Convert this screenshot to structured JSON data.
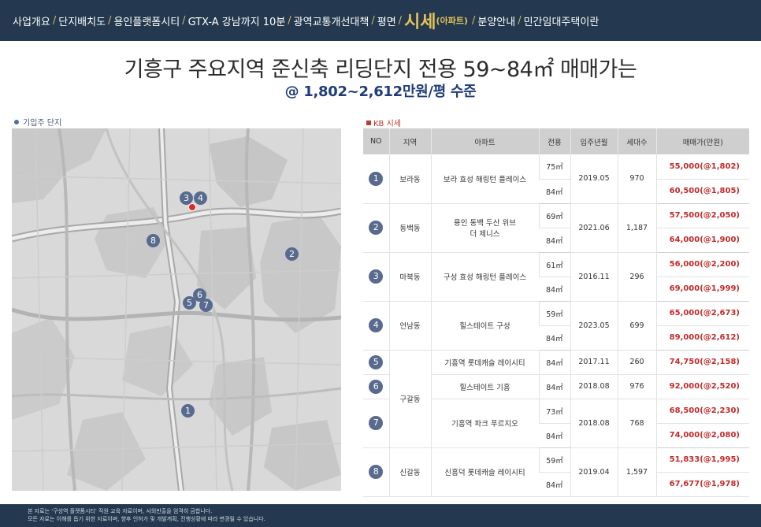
{
  "nav": {
    "items": [
      "사업개요",
      "단지배치도",
      "용인플랫폼시티",
      "GTX-A 강남까지 10분",
      "광역교통개선대책",
      "평면"
    ],
    "active": "시세",
    "active_sub": "(아파트)",
    "items_after": [
      "분양안내",
      "민간임대주택이란"
    ],
    "separator": "/"
  },
  "headline": {
    "main": "기흥구 주요지역 준신축 리딩단지 전용 59~84㎡ 매매가는",
    "sub": "@ 1,802~2,612만원/평 수준"
  },
  "map": {
    "legend": "기입주 단지"
  },
  "table": {
    "title": "KB 시세",
    "headers": [
      "NO",
      "지역",
      "아파트",
      "전용",
      "입주년월",
      "세대수",
      "매매가(만원)"
    ],
    "groups": [
      {
        "region": "보라동",
        "entries": [
          {
            "no": "1",
            "apt": "보라 효성 해링턴 플레이스",
            "move_in": "2019.05",
            "households": "970",
            "rows": [
              {
                "area": "75㎡",
                "price": "55,000(@1,802)"
              },
              {
                "area": "84㎡",
                "price": "60,500(@1,805)"
              }
            ]
          }
        ]
      },
      {
        "region": "동백동",
        "entries": [
          {
            "no": "2",
            "apt": "용인 동백 두산 위브 더 제니스",
            "move_in": "2021.06",
            "households": "1,187",
            "rows": [
              {
                "area": "69㎡",
                "price": "57,500(@2,050)"
              },
              {
                "area": "84㎡",
                "price": "64,000(@1,900)"
              }
            ]
          }
        ]
      },
      {
        "region": "마북동",
        "entries": [
          {
            "no": "3",
            "apt": "구성 효성 해링턴 플레이스",
            "move_in": "2016.11",
            "households": "296",
            "rows": [
              {
                "area": "61㎡",
                "price": "56,000(@2,200)"
              },
              {
                "area": "84㎡",
                "price": "69,000(@1,999)"
              }
            ]
          }
        ]
      },
      {
        "region": "언남동",
        "entries": [
          {
            "no": "4",
            "apt": "힐스테이트 구성",
            "move_in": "2023.05",
            "households": "699",
            "rows": [
              {
                "area": "59㎡",
                "price": "65,000(@2,673)"
              },
              {
                "area": "84㎡",
                "price": "89,000(@2,612)"
              }
            ]
          }
        ]
      },
      {
        "region": "구갈동",
        "entries": [
          {
            "no": "5",
            "apt": "기흥역 롯데캐슬 레이시티",
            "move_in": "2017.11",
            "households": "260",
            "rows": [
              {
                "area": "84㎡",
                "price": "74,750(@2,158)"
              }
            ]
          },
          {
            "no": "6",
            "apt": "힐스테이트 기흥",
            "move_in": "2018.08",
            "households": "976",
            "rows": [
              {
                "area": "84㎡",
                "price": "92,000(@2,520)"
              }
            ]
          },
          {
            "no": "7",
            "apt": "기흥역 파크 푸르지오",
            "move_in": "2018.08",
            "households": "768",
            "rows": [
              {
                "area": "73㎡",
                "price": "68,500(@2,230)"
              },
              {
                "area": "84㎡",
                "price": "74,000(@2,080)"
              }
            ]
          }
        ]
      },
      {
        "region": "신갈동",
        "entries": [
          {
            "no": "8",
            "apt": "신흥덕 롯데캐슬 레이시티",
            "move_in": "2019.04",
            "households": "1,597",
            "rows": [
              {
                "area": "59㎡",
                "price": "51,833(@1,995)"
              },
              {
                "area": "84㎡",
                "price": "67,677(@1,978)"
              }
            ]
          }
        ]
      }
    ]
  },
  "footer": {
    "line1": "본 자료는 '구성역 플랫폼시티' 직원 교육 자료이며, 사외반출을 엄격히 금합니다.",
    "line2": "모든 자료는 이해를 돕기 위한 자료이며, 향후 인허가 및 개발계획, 진행상황에 따라 변경될 수 있습니다."
  },
  "colors": {
    "navy": "#24394f",
    "gold": "#e4c259",
    "price_red": "#c02b2b",
    "marker": "#586b8f"
  }
}
